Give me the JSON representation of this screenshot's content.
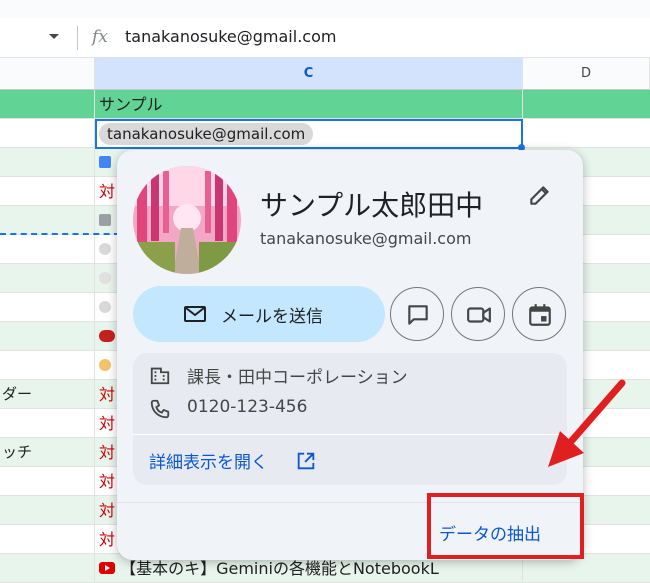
{
  "formula_bar": {
    "fx_label": "fx",
    "value": "tanakanosuke@gmail.com"
  },
  "columns": [
    "C",
    "D"
  ],
  "rows": [
    {
      "b": "",
      "c": "サンプル"
    },
    {
      "b": "",
      "c_chip": "tanakanosuke@gmail.com"
    },
    {
      "b": "",
      "c": ""
    },
    {
      "b": "対",
      "c": ""
    },
    {
      "b": "",
      "c": ""
    },
    {
      "b": "",
      "c": ""
    },
    {
      "b": "",
      "c": ""
    },
    {
      "b": "",
      "c": ""
    },
    {
      "b": "",
      "c": ""
    },
    {
      "b": "",
      "c": ""
    },
    {
      "b": "ダー",
      "b2": "対"
    },
    {
      "b": "",
      "b2": "対"
    },
    {
      "b": "ッチ",
      "b2": "対"
    },
    {
      "b": "",
      "b2": "対"
    },
    {
      "b": "",
      "b2": "対"
    },
    {
      "b": "",
      "b2": "対"
    }
  ],
  "bottom_row_text": "【基本のキ】Geminiの各機能とNotebookL",
  "card": {
    "name": "サンプル太郎田中",
    "email": "tanakanosuke@gmail.com",
    "send_mail_label": "メールを送信",
    "title": "課長・田中コーポレーション",
    "phone": "0120-123-456",
    "open_details_label": "詳細表示を開く",
    "extract_label": "データの抽出"
  },
  "colors": {
    "accent": "#0b57d0",
    "mail_button": "#c2e7ff",
    "header_green": "#61d394",
    "annotation": "#e02020"
  }
}
